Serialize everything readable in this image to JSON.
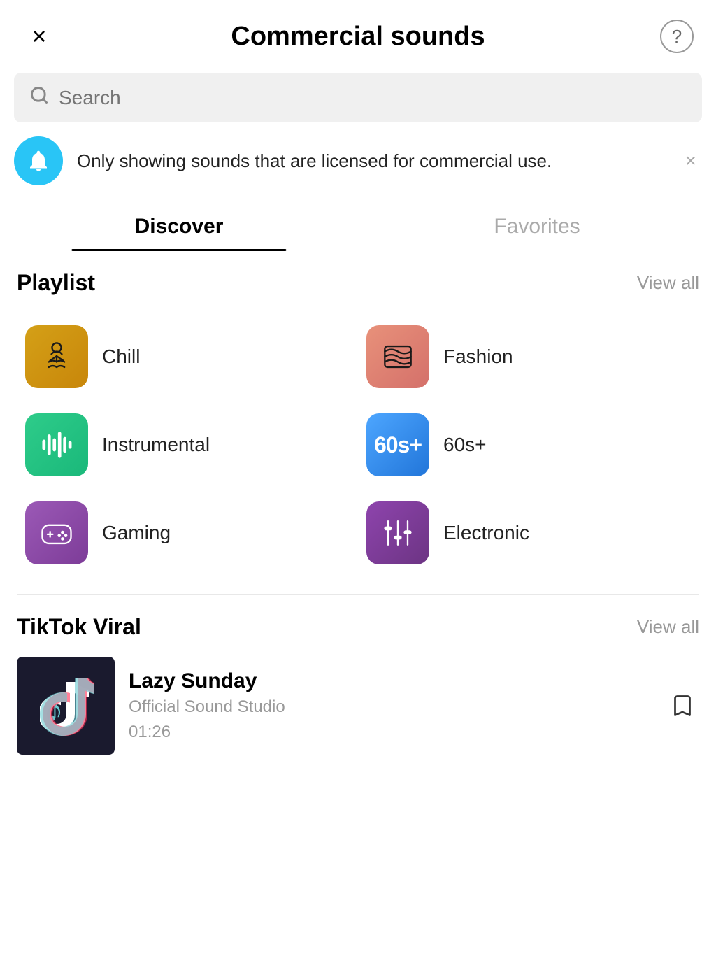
{
  "header": {
    "title": "Commercial sounds",
    "close_label": "×",
    "help_label": "?"
  },
  "search": {
    "placeholder": "Search"
  },
  "notice": {
    "text": "Only showing sounds that are licensed for commercial use."
  },
  "tabs": [
    {
      "id": "discover",
      "label": "Discover",
      "active": true
    },
    {
      "id": "favorites",
      "label": "Favorites",
      "active": false
    }
  ],
  "playlist": {
    "section_title": "Playlist",
    "view_all_label": "View all",
    "items": [
      {
        "id": "chill",
        "label": "Chill",
        "icon_class": "icon-chill"
      },
      {
        "id": "fashion",
        "label": "Fashion",
        "icon_class": "icon-fashion"
      },
      {
        "id": "instrumental",
        "label": "Instrumental",
        "icon_class": "icon-instrumental"
      },
      {
        "id": "60s",
        "label": "60s+",
        "icon_class": "icon-60s"
      },
      {
        "id": "gaming",
        "label": "Gaming",
        "icon_class": "icon-gaming"
      },
      {
        "id": "electronic",
        "label": "Electronic",
        "icon_class": "icon-electronic"
      }
    ]
  },
  "tiktok_viral": {
    "section_title": "TikTok Viral",
    "view_all_label": "View all",
    "items": [
      {
        "id": "lazy-sunday",
        "title": "Lazy Sunday",
        "artist": "Official Sound Studio",
        "duration": "01:26"
      }
    ]
  }
}
